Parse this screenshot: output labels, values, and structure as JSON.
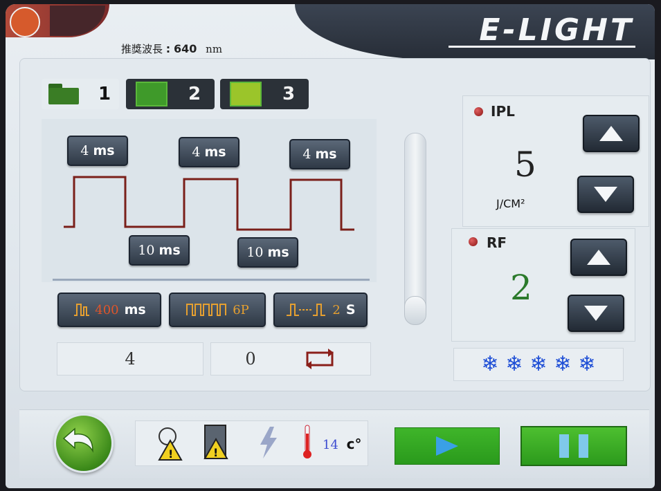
{
  "header": {
    "brand": "E-LIGHT",
    "wavelength_label": "推獎波長",
    "wavelength_sep": ":",
    "wavelength_value": "640",
    "wavelength_unit": "nm"
  },
  "tabs": [
    {
      "number": "1",
      "icon": "folder-icon",
      "color": "#3a7d25"
    },
    {
      "number": "2",
      "icon": "green-square-icon",
      "color": "#3f9a2a"
    },
    {
      "number": "3",
      "icon": "yellow-green-square-icon",
      "color": "#9bc52a"
    }
  ],
  "pulse": {
    "on_buttons": [
      {
        "value": "4",
        "unit": "ms"
      },
      {
        "value": "4",
        "unit": "ms"
      },
      {
        "value": "4",
        "unit": "ms"
      }
    ],
    "off_buttons": [
      {
        "value": "10",
        "unit": "ms"
      },
      {
        "value": "10",
        "unit": "ms"
      }
    ]
  },
  "controls": {
    "delay": {
      "value": "400",
      "unit": "ms"
    },
    "pulses": {
      "value": "6P"
    },
    "interval": {
      "value": "2",
      "unit": "S"
    }
  },
  "counters": {
    "left": "4",
    "right": "0"
  },
  "ipl": {
    "label": "IPL",
    "value": "5",
    "unit": "J/CM²"
  },
  "rf": {
    "label": "RF",
    "value": "2",
    "value_color": "#2b7a2b"
  },
  "cooling": {
    "level": 5,
    "max": 5,
    "icon": "snowflake-icon"
  },
  "status": {
    "temperature": "14",
    "temp_unit": "c°"
  },
  "colors": {
    "accent_green": "#3fb52a",
    "warning_yellow": "#f0d020",
    "dark_button": "#2f3946"
  }
}
